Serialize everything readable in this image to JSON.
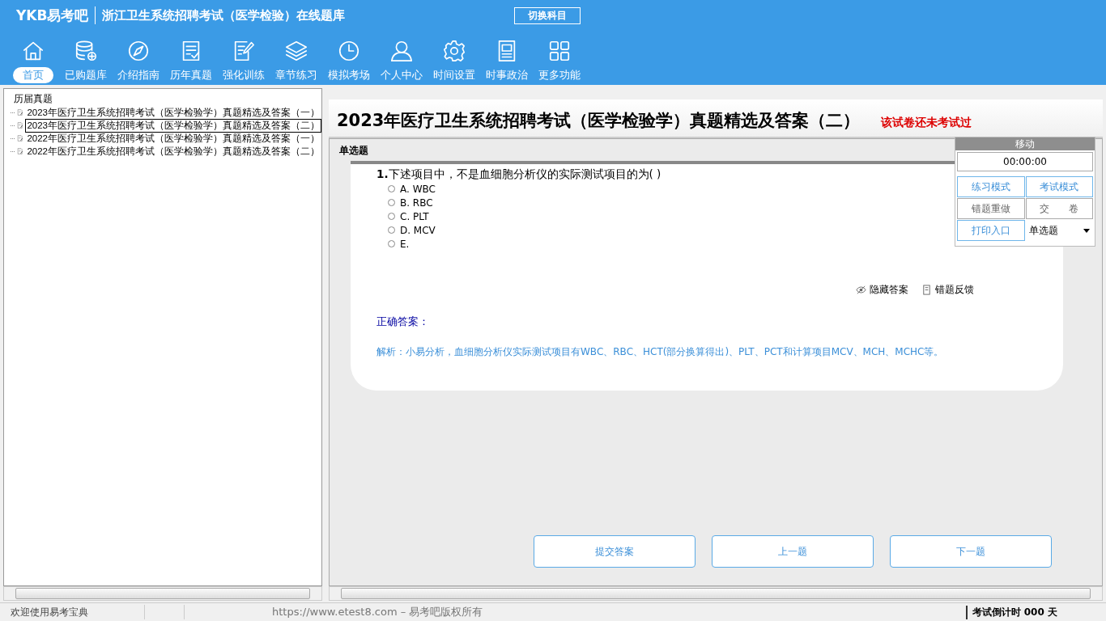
{
  "header": {
    "logo": "YKB易考吧",
    "title": "浙江卫生系统招聘考试（医学检验）在线题库",
    "switch_button": "切换科目"
  },
  "nav": [
    {
      "label": "首页",
      "selected": true
    },
    {
      "label": "已购题库",
      "selected": false
    },
    {
      "label": "介绍指南",
      "selected": false
    },
    {
      "label": "历年真题",
      "selected": false
    },
    {
      "label": "强化训练",
      "selected": false
    },
    {
      "label": "章节练习",
      "selected": false
    },
    {
      "label": "模拟考场",
      "selected": false
    },
    {
      "label": "个人中心",
      "selected": false
    },
    {
      "label": "时间设置",
      "selected": false
    },
    {
      "label": "时事政治",
      "selected": false
    },
    {
      "label": "更多功能",
      "selected": false
    }
  ],
  "tree": {
    "root": "历届真题",
    "children": [
      {
        "label": "2023年医疗卫生系统招聘考试（医学检验学）真题精选及答案（一）",
        "selected": false
      },
      {
        "label": "2023年医疗卫生系统招聘考试（医学检验学）真题精选及答案（二）",
        "selected": true
      },
      {
        "label": "2022年医疗卫生系统招聘考试（医学检验学）真题精选及答案（一）",
        "selected": false
      },
      {
        "label": "2022年医疗卫生系统招聘考试（医学检验学）真题精选及答案（二）",
        "selected": false
      }
    ]
  },
  "paper": {
    "title": "2023年医疗卫生系统招聘考试（医学检验学）真题精选及答案（二）",
    "status": "该试卷还未考试过"
  },
  "section": "单选题",
  "question": {
    "number": "1.",
    "text": "下述项目中，不是血细胞分析仪的实际测试项目的为( )",
    "options": [
      {
        "label": "A. WBC",
        "selected": false
      },
      {
        "label": "B. RBC",
        "selected": false
      },
      {
        "label": "C. PLT",
        "selected": false
      },
      {
        "label": "D. MCV",
        "selected": false
      },
      {
        "label": "E.",
        "selected": false
      }
    ],
    "actions": [
      "隐藏答案",
      "错题反馈"
    ],
    "answer": "正确答案：",
    "analysis": "解析：小易分析，血细胞分析仪实际测试项目有WBC、RBC、HCT(部分换算得出)、PLT、PCT和计算项目MCV、MCH、MCHC等。"
  },
  "panel": {
    "move": "移动",
    "timer": "00:00:00",
    "buttons": [
      "练习模式",
      "考试模式",
      "错题重做",
      "交　　卷",
      "打印入口"
    ],
    "type_select": "单选题"
  },
  "bottom_buttons": [
    "提交答案",
    "上一题",
    "下一题"
  ],
  "status_bar": {
    "welcome": "欢迎使用易考宝典",
    "site": "https://www.etest8.com – 易考吧版权所有",
    "countdown": "考试倒计时 000 天"
  }
}
